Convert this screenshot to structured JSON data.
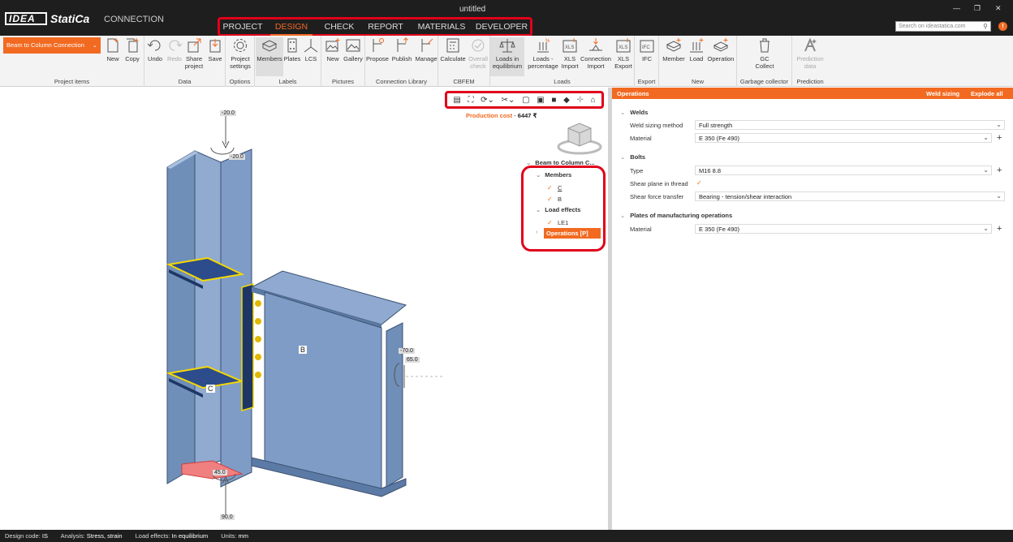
{
  "app": {
    "logo_text": "IDEA",
    "brand": "StatiCa",
    "product": "CONNECTION",
    "window_title": "untitled",
    "search_placeholder": "Search on ideastatica.com",
    "info": "!"
  },
  "main_tabs": [
    "PROJECT",
    "DESIGN",
    "CHECK",
    "REPORT",
    "MATERIALS",
    "DEVELOPER"
  ],
  "active_tab": "DESIGN",
  "ribbon": {
    "project_select": "Beam to Column Connection",
    "groups": {
      "project_items": "Project items",
      "data": "Data",
      "options": "Options",
      "labels": "Labels",
      "pictures": "Pictures",
      "connection_library": "Connection Library",
      "cbfem": "CBFEM",
      "loads": "Loads",
      "export": "Export",
      "new": "New",
      "garbage": "Garbage collector",
      "prediction": "Prediction"
    },
    "buttons": {
      "new": "New",
      "copy": "Copy",
      "undo": "Undo",
      "redo": "Redo",
      "share": "Share project",
      "save": "Save",
      "project_settings": "Project settings",
      "members": "Members",
      "plates": "Plates",
      "lcs": "LCS",
      "pic_new": "New",
      "gallery": "Gallery",
      "propose": "Propose",
      "publish": "Publish",
      "manage": "Manage",
      "calculate": "Calculate",
      "overall_check": "Overall check",
      "loads_equilibrium": "Loads in equilibrium",
      "loads_percentage": "Loads - percentage",
      "xls_import": "XLS Import",
      "connection_import": "Connection Import",
      "xls_export": "XLS Export",
      "ifc": "IFC",
      "member": "Member",
      "load": "Load",
      "operation": "Operation",
      "gc_collect": "GC Collect",
      "prediction_data": "Prediction data"
    }
  },
  "viewport": {
    "production_cost_label": "Production cost",
    "production_cost_value": "6447 ₹",
    "tree": {
      "root": "Beam to Column C...",
      "members": "Members",
      "member_c": "C",
      "member_b": "B",
      "load_effects": "Load effects",
      "le1": "LE1",
      "operations": "Operations [P]"
    },
    "model_labels": {
      "column": "C",
      "beam": "B"
    },
    "dims": {
      "top1": "-20.0",
      "top2": "-20.0",
      "right1": "-70.0",
      "right2": "65.0",
      "bottom1": "45.0",
      "bottom2": "90.0"
    }
  },
  "panel": {
    "title": "Operations",
    "weld_sizing": "Weld sizing",
    "explode_all": "Explode all",
    "welds": {
      "title": "Welds",
      "sizing_method_label": "Weld sizing method",
      "sizing_method": "Full strength",
      "material_label": "Material",
      "material": "E 350 (Fe 490)"
    },
    "bolts": {
      "title": "Bolts",
      "type_label": "Type",
      "type": "M16 8.8",
      "shear_plane_label": "Shear plane in thread",
      "shear_force_label": "Shear force transfer",
      "shear_force": "Bearing - tension/shear interaction"
    },
    "plates": {
      "title": "Plates of manufacturing operations",
      "material_label": "Material",
      "material": "E 350 (Fe 490)"
    }
  },
  "status": {
    "design_code_label": "Design code:",
    "design_code": "IS",
    "analysis_label": "Analysis:",
    "analysis": "Stress, strain",
    "load_effects_label": "Load effects:",
    "load_effects": "In equilibrium",
    "units_label": "Units:",
    "units": "mm"
  },
  "colors": {
    "accent": "#f26a21",
    "highlight": "#e0001a",
    "steel": "#6f8fb8",
    "weld": "#f5d800"
  }
}
